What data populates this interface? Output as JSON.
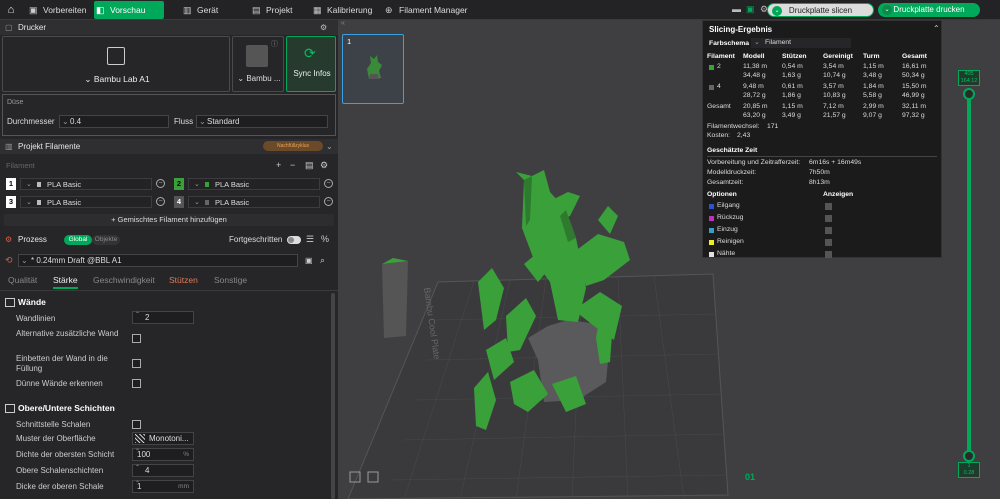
{
  "topbar": {
    "tabs": [
      {
        "label": "Vorbereiten",
        "icon": "cube-icon"
      },
      {
        "label": "Vorschau",
        "icon": "preview-icon",
        "active": true
      },
      {
        "label": "Gerät",
        "icon": "device-icon"
      },
      {
        "label": "Projekt",
        "icon": "project-icon"
      },
      {
        "label": "Kalibrierung",
        "icon": "calibration-icon"
      },
      {
        "label": "Filament Manager",
        "icon": "filament-manager-icon"
      }
    ],
    "slice_label": "Druckplatte slicen",
    "print_label": "Druckplatte drucken"
  },
  "printer": {
    "section_title": "Drucker",
    "printer_name": "Bambu Lab A1",
    "plate_name": "Bambu ...",
    "sync_label": "Sync Infos"
  },
  "nozzle": {
    "title": "Düse",
    "diameter_label": "Durchmesser",
    "diameter_value": "0.4",
    "flow_label": "Fluss",
    "flow_value": "Standard"
  },
  "filaments": {
    "section_title": "Projekt Filamente",
    "badge": "Nachfüllzyklus",
    "sub_label": "Filament",
    "items": [
      {
        "num": "1",
        "name": "PLA Basic",
        "num_bg": "#ffffff",
        "num_fg": "#000000",
        "swatch": "#bbbbbb"
      },
      {
        "num": "2",
        "name": "PLA Basic",
        "num_bg": "#3aa13a",
        "num_fg": "#000000",
        "swatch": "#3aa13a"
      },
      {
        "num": "3",
        "name": "PLA Basic",
        "num_bg": "#ffffff",
        "num_fg": "#000000",
        "swatch": "#bbbbbb"
      },
      {
        "num": "4",
        "name": "PLA Basic",
        "num_bg": "#555555",
        "num_fg": "#ffffff",
        "swatch": "#666666"
      }
    ],
    "mix_label": "+ Gemischtes Filament hinzufügen"
  },
  "process": {
    "section_title": "Prozess",
    "global_label": "Global",
    "object_label": "Objekte",
    "advanced_label": "Fortgeschritten",
    "profile": "* 0.24mm Draft @BBL A1",
    "subtabs": [
      "Qualität",
      "Stärke",
      "Geschwindigkeit",
      "Stützen",
      "Sonstige"
    ]
  },
  "walls": {
    "title": "Wände",
    "wall_loops_label": "Wandlinien",
    "wall_loops_value": "2",
    "alt_label": "Alternative zusätzliche Wand",
    "embed_label": "Einbetten der Wand in die Füllung",
    "thin_label": "Dünne Wände erkennen"
  },
  "shells": {
    "title": "Obere/Untere Schichten",
    "interface_label": "Schnittstelle Schalen",
    "pattern_label": "Muster der Oberfläche",
    "pattern_value": "Monotoni...",
    "density_label": "Dichte der obersten Schicht",
    "density_value": "100",
    "density_unit": "%",
    "top_layers_label": "Obere Schalenschichten",
    "top_layers_value": "4",
    "top_thick_label": "Dicke der oberen Schale",
    "top_thick_value": "1",
    "top_thick_unit": "mm"
  },
  "viewport": {
    "plate_number": "1",
    "plate_logo": "Bambu Cool Plate",
    "layer_top": "405",
    "layer_top_h": "164.12",
    "layer_bottom": "1",
    "layer_bottom_h": "0.28",
    "bottom_layer_mark": "01"
  },
  "slicing": {
    "title": "Slicing-Ergebnis",
    "scheme_label": "Farbschema",
    "scheme_value": "Filament",
    "headers": [
      "Filament",
      "Modell",
      "Stützen",
      "Gereinigt",
      "Turm",
      "Gesamt"
    ],
    "rows": [
      {
        "id": "2",
        "color": "#3aa13a",
        "model": "11,38 m",
        "model_g": "34,48 g",
        "sup": "0,54 m",
        "sup_g": "1,63 g",
        "purge": "3,54 m",
        "purge_g": "10,74 g",
        "tower": "1,15 m",
        "tower_g": "3,48 g",
        "total": "16,61 m",
        "total_g": "50,34 g"
      },
      {
        "id": "4",
        "color": "#666666",
        "model": "9,48 m",
        "model_g": "28,72 g",
        "sup": "0,61 m",
        "sup_g": "1,86 g",
        "purge": "3,57 m",
        "purge_g": "10,83 g",
        "tower": "1,84 m",
        "tower_g": "5,58 g",
        "total": "15,50 m",
        "total_g": "46,99 g"
      }
    ],
    "sum": {
      "label": "Gesamt",
      "model": "20,85 m",
      "model_g": "63,20 g",
      "sup": "1,15 m",
      "sup_g": "3,49 g",
      "purge": "7,12 m",
      "purge_g": "21,57 g",
      "tower": "2,99 m",
      "tower_g": "9,07 g",
      "total": "32,11 m",
      "total_g": "97,32 g"
    },
    "changes_label": "Filamentwechsel:",
    "changes_value": "171",
    "cost_label": "Kosten:",
    "cost_value": "2,43",
    "time_title": "Geschätzte Zeit",
    "prep_label": "Vorbereitung und Zeitrafferzeit:",
    "prep_value": "6m16s + 16m49s",
    "model_time_label": "Modelldruckzeit:",
    "model_time_value": "7h50m",
    "total_time_label": "Gesamtzeit:",
    "total_time_value": "8h13m",
    "options_label": "Optionen",
    "show_label": "Anzeigen",
    "options": [
      {
        "label": "Eilgang",
        "color": "#3050d0"
      },
      {
        "label": "Rückzug",
        "color": "#c030c0"
      },
      {
        "label": "Einzug",
        "color": "#30a0d0"
      },
      {
        "label": "Reinigen",
        "color": "#f0f020"
      },
      {
        "label": "Nähte",
        "color": "#e0e0e0"
      }
    ]
  }
}
